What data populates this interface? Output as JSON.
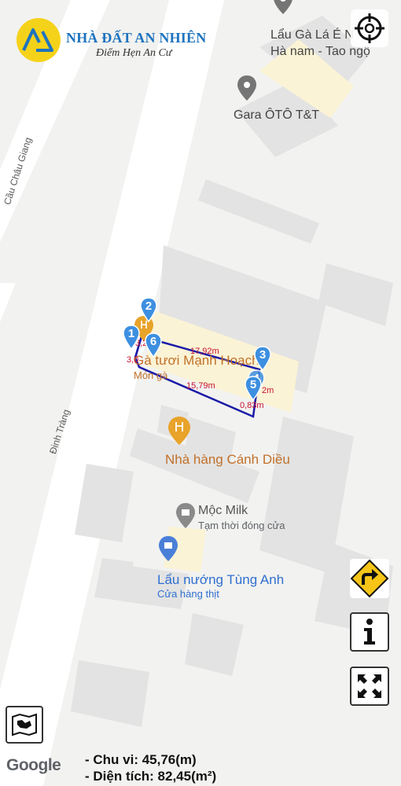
{
  "brand": {
    "name": "NHÀ ĐẤT AN NHIÊN",
    "slogan": "Điểm Hẹn An Cư"
  },
  "roads": {
    "upper": "Cầu Châu Giang",
    "lower": "Đinh Tràng"
  },
  "pois": {
    "lau_ga": {
      "name_line1": "Lẩu Gà Lá É N",
      "name_line2": "Hà nam - Tao ngộ"
    },
    "gara": {
      "name": "Gara ÔTÔ T&T"
    },
    "manh_hoach": {
      "name": "Gà tươi Mạnh Hoạch",
      "category": "Món gà"
    },
    "canh_dieu": {
      "name": "Nhà hàng Cánh Diều"
    },
    "moc_milk": {
      "name": "Mộc Milk",
      "status": "Tạm thời đóng cửa"
    },
    "tung_anh": {
      "name": "Lẩu nướng Tùng Anh",
      "category": "Cửa hàng thịt"
    }
  },
  "parcel": {
    "vertices": [
      "1",
      "2",
      "3",
      "4",
      "5",
      "6"
    ],
    "edges": {
      "top": "17,92m",
      "bottom": "15,79m",
      "right_small": "0,83m",
      "right_label": "2m",
      "left_a": "3,0",
      "left_b": "3,2"
    }
  },
  "footer": {
    "google": "Google",
    "perimeter": "- Chu vi: 45,76(m)",
    "area": "- Diện tích: 82,45(m²)"
  },
  "icons": {
    "locate": "crosshair-icon",
    "directions": "turn-right-sign-icon",
    "info": "info-icon",
    "fullscreen": "fullscreen-icon",
    "layers": "map-layers-icon"
  },
  "colors": {
    "parcel_line": "#1a1aa8",
    "marker": "#3d8fe0",
    "poi_orange": "#e8a32a",
    "poi_grey": "#757575",
    "poi_blue": "#4a7fd8",
    "road": "#ffffff",
    "measure": "#c8102e"
  }
}
